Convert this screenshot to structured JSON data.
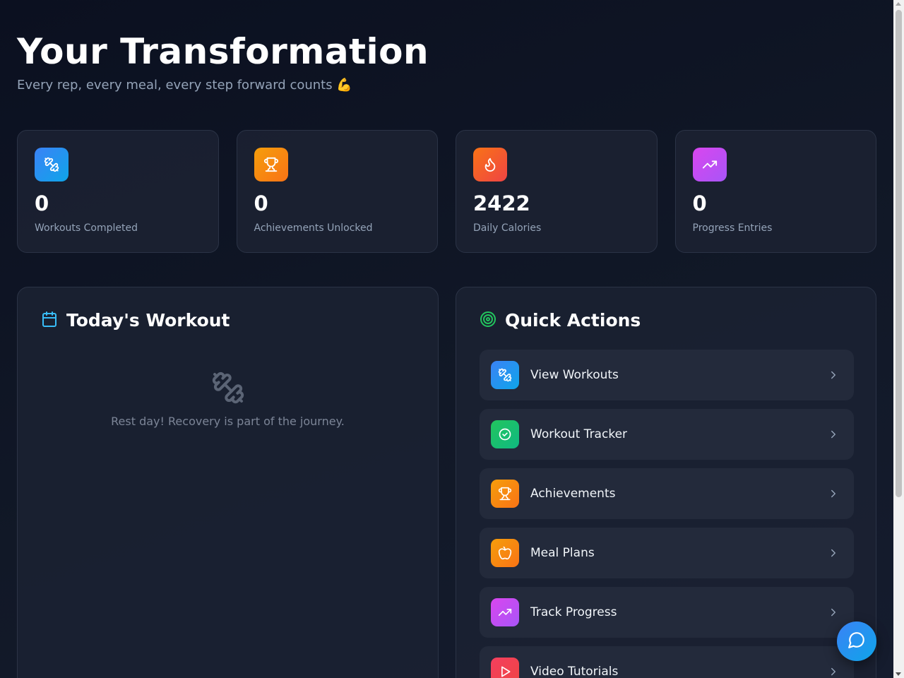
{
  "header": {
    "title": "Your Transformation",
    "subtitle": "Every rep, every meal, every step forward counts 💪"
  },
  "stats": [
    {
      "value": "0",
      "label": "Workouts Completed",
      "icon": "dumbbell-icon",
      "color": "#3b82f6"
    },
    {
      "value": "0",
      "label": "Achievements Unlocked",
      "icon": "trophy-icon",
      "color": "#f59e0b"
    },
    {
      "value": "2422",
      "label": "Daily Calories",
      "icon": "flame-icon",
      "color": "#ef4444"
    },
    {
      "value": "0",
      "label": "Progress Entries",
      "icon": "trending-up-icon",
      "color": "#d946ef"
    }
  ],
  "today": {
    "title": "Today's Workout",
    "icon": "calendar-icon",
    "empty_message": "Rest day! Recovery is part of the journey."
  },
  "quick_actions": {
    "title": "Quick Actions",
    "icon": "target-icon",
    "items": [
      {
        "label": "View Workouts",
        "icon": "dumbbell-icon"
      },
      {
        "label": "Workout Tracker",
        "icon": "check-circle-icon"
      },
      {
        "label": "Achievements",
        "icon": "trophy-icon"
      },
      {
        "label": "Meal Plans",
        "icon": "apple-icon"
      },
      {
        "label": "Track Progress",
        "icon": "trending-up-icon"
      },
      {
        "label": "Video Tutorials",
        "icon": "play-icon"
      }
    ]
  },
  "chat": {
    "icon": "chat-bubble-icon"
  }
}
